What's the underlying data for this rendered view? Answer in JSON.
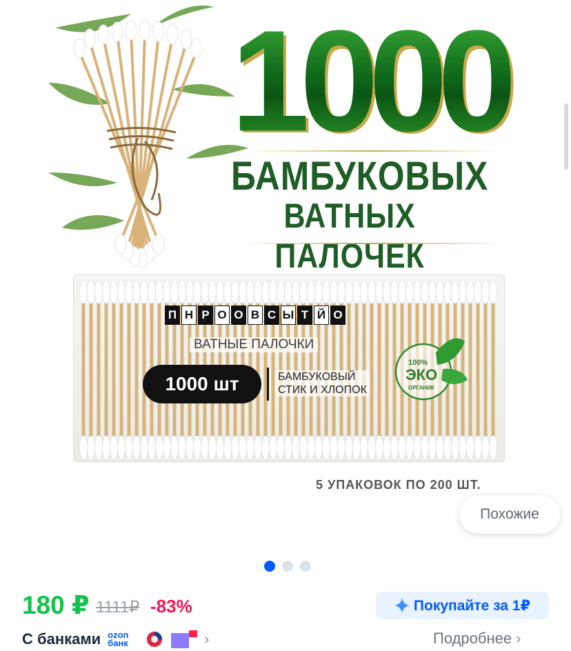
{
  "image": {
    "headline_number": "1000",
    "headline_line1": "БАМБУКОВЫХ",
    "headline_line2": "ВАТНЫХ ПАЛОЧЕК",
    "package": {
      "brand_letters": [
        "П",
        "Н",
        "Р",
        "О",
        "О",
        "В",
        "С",
        "Ы",
        "Т",
        "Й",
        "О"
      ],
      "subtitle": "ВАТНЫЕ ПАЛОЧКИ",
      "count": "1000 шт",
      "desc_line1": "БАМБУКОВЫЙ",
      "desc_line2": "СТИК И ХЛОПОК",
      "eco_pct": "100%",
      "eco_word": "ЭКО",
      "eco_sub": "ОРГАНИК"
    },
    "pack_note": "5 УПАКОВОК ПО 200 ШТ."
  },
  "similar_button": "Похожие",
  "gallery": {
    "count": 3,
    "active": 0
  },
  "price": {
    "current": "180 ₽",
    "old": "1111₽",
    "discount": "-83%"
  },
  "promo": {
    "label": "Покупайте за 1₽",
    "icon": "sparkle-icon"
  },
  "banks": {
    "label": "С банками",
    "ozon_line1": "ozon",
    "ozon_line2": "банк"
  },
  "more_link": "Подробнее",
  "colors": {
    "price_green": "#10c44c",
    "discount_red": "#f91155",
    "accent_blue": "#005bff",
    "promo_bg": "#e8f3ff"
  }
}
